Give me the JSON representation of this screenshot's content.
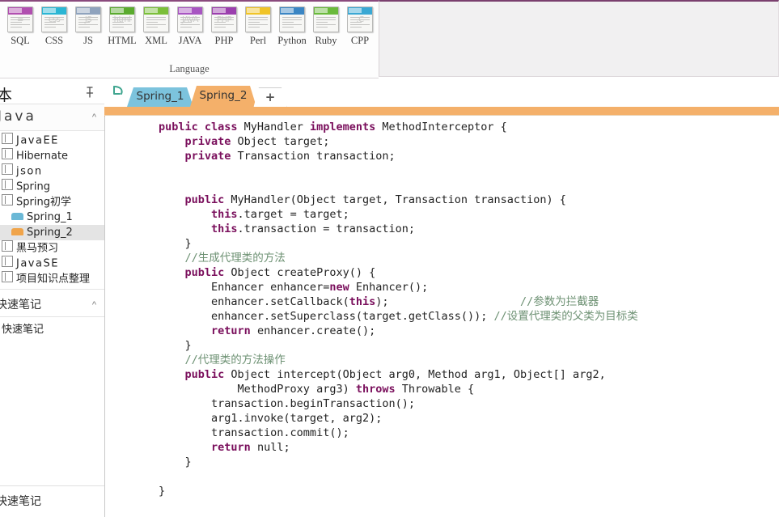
{
  "ribbon": {
    "group_title": "Language",
    "languages": [
      {
        "label": "SQL",
        "icon": "sql-file-icon",
        "color": "#b14fb0",
        "glyph": "≡"
      },
      {
        "label": "CSS",
        "icon": "css-file-icon",
        "color": "#2bb6d4",
        "glyph": "css"
      },
      {
        "label": "JS",
        "icon": "js-file-icon",
        "color": "#8fa3bd",
        "glyph": "JS"
      },
      {
        "label": "HTML",
        "icon": "html-file-icon",
        "color": "#5aab2e",
        "glyph": "html"
      },
      {
        "label": "XML",
        "icon": "xml-file-icon",
        "color": "#7bbf3a",
        "glyph": ""
      },
      {
        "label": "JAVA",
        "icon": "java-file-icon",
        "color": "#a855c2",
        "glyph": "JAVA"
      },
      {
        "label": "PHP",
        "icon": "php-file-icon",
        "color": "#9b3fae",
        "glyph": "PHP"
      },
      {
        "label": "Perl",
        "icon": "perl-file-icon",
        "color": "#f0c428",
        "glyph": ""
      },
      {
        "label": "Python",
        "icon": "python-file-icon",
        "color": "#3b86c4",
        "glyph": ""
      },
      {
        "label": "Ruby",
        "icon": "ruby-file-icon",
        "color": "#6aba3c",
        "glyph": ""
      },
      {
        "label": "CPP",
        "icon": "cpp-file-icon",
        "color": "#3aa8d4",
        "glyph": ".C"
      }
    ]
  },
  "sidebar": {
    "top_title": "本",
    "pin_icon": "pin-icon",
    "section_header": {
      "label": "Java",
      "chevron": "chevron-up-icon"
    },
    "items": [
      {
        "label": "JavaEE",
        "icon": "notebook-icon",
        "indent": false,
        "selected": false,
        "spaced": true
      },
      {
        "label": "Hibernate",
        "icon": "notebook-icon",
        "indent": false,
        "selected": false,
        "spaced": false
      },
      {
        "label": "json",
        "icon": "notebook-icon",
        "indent": false,
        "selected": false,
        "spaced": true
      },
      {
        "label": "Spring",
        "icon": "notebook-icon",
        "indent": false,
        "selected": false,
        "spaced": false
      },
      {
        "label": "Spring初学",
        "icon": "notebook-icon",
        "indent": false,
        "selected": false,
        "spaced": false
      },
      {
        "label": "Spring_1",
        "icon": "section-tab-icon",
        "indent": true,
        "selected": false,
        "color": "#6bb8d6",
        "spaced": false
      },
      {
        "label": "Spring_2",
        "icon": "section-tab-icon",
        "indent": true,
        "selected": true,
        "color": "#f0a44a",
        "spaced": false
      },
      {
        "label": "黑马预习",
        "icon": "notebook-icon",
        "indent": false,
        "selected": false,
        "spaced": false
      },
      {
        "label": "JavaSE",
        "icon": "notebook-icon",
        "indent": false,
        "selected": false,
        "spaced": true
      },
      {
        "label": "项目知识点整理",
        "icon": "notebook-icon",
        "indent": false,
        "selected": false,
        "spaced": false
      }
    ],
    "quick_notes_section": {
      "label": "快速笔记",
      "chevron": "chevron-up-icon"
    },
    "quick_notes_item": {
      "label": "快速笔记"
    },
    "footer_item": {
      "label": "快速笔记"
    }
  },
  "tabstrip": {
    "undo_icon": "undo-arrow-icon",
    "tabs": [
      {
        "label": "Spring_1",
        "color": "#7cc3dd",
        "active": false
      },
      {
        "label": "Spring_2",
        "color": "#f4b06a",
        "active": true
      }
    ],
    "add_tab": {
      "label": "+",
      "icon": "plus-icon"
    },
    "active_color": "#f4b06a",
    "underline_color": "#f0a970"
  },
  "code": {
    "lines": [
      [
        {
          "t": "kw",
          "s": "public class "
        },
        {
          "t": "pl",
          "s": "MyHandler "
        },
        {
          "t": "kw",
          "s": "implements "
        },
        {
          "t": "pl",
          "s": "MethodInterceptor {"
        }
      ],
      [
        {
          "t": "pl",
          "s": "    "
        },
        {
          "t": "kw",
          "s": "private "
        },
        {
          "t": "pl",
          "s": "Object target;"
        }
      ],
      [
        {
          "t": "pl",
          "s": "    "
        },
        {
          "t": "kw",
          "s": "private "
        },
        {
          "t": "pl",
          "s": "Transaction transaction;"
        }
      ],
      [
        {
          "t": "pl",
          "s": ""
        }
      ],
      [
        {
          "t": "pl",
          "s": ""
        }
      ],
      [
        {
          "t": "pl",
          "s": "    "
        },
        {
          "t": "kw",
          "s": "public "
        },
        {
          "t": "pl",
          "s": "MyHandler(Object target, Transaction transaction) {"
        }
      ],
      [
        {
          "t": "pl",
          "s": "        "
        },
        {
          "t": "kw",
          "s": "this"
        },
        {
          "t": "pl",
          "s": ".target = target;"
        }
      ],
      [
        {
          "t": "pl",
          "s": "        "
        },
        {
          "t": "kw",
          "s": "this"
        },
        {
          "t": "pl",
          "s": ".transaction = transaction;"
        }
      ],
      [
        {
          "t": "pl",
          "s": "    }"
        }
      ],
      [
        {
          "t": "pl",
          "s": "    "
        },
        {
          "t": "cm",
          "s": "//生成代理类的方法"
        }
      ],
      [
        {
          "t": "pl",
          "s": "    "
        },
        {
          "t": "kw",
          "s": "public "
        },
        {
          "t": "pl",
          "s": "Object createProxy() {"
        }
      ],
      [
        {
          "t": "pl",
          "s": "        Enhancer enhancer="
        },
        {
          "t": "kw",
          "s": "new "
        },
        {
          "t": "pl",
          "s": "Enhancer();"
        }
      ],
      [
        {
          "t": "pl",
          "s": "        enhancer.setCallback("
        },
        {
          "t": "kw",
          "s": "this"
        },
        {
          "t": "pl",
          "s": ");                    "
        },
        {
          "t": "cm",
          "s": "//参数为拦截器"
        }
      ],
      [
        {
          "t": "pl",
          "s": "        enhancer.setSuperclass(target.getClass()); "
        },
        {
          "t": "cm",
          "s": "//设置代理类的父类为目标类"
        }
      ],
      [
        {
          "t": "pl",
          "s": "        "
        },
        {
          "t": "kw",
          "s": "return "
        },
        {
          "t": "pl",
          "s": "enhancer.create();"
        }
      ],
      [
        {
          "t": "pl",
          "s": "    }"
        }
      ],
      [
        {
          "t": "pl",
          "s": "    "
        },
        {
          "t": "cm",
          "s": "//代理类的方法操作"
        }
      ],
      [
        {
          "t": "pl",
          "s": "    "
        },
        {
          "t": "kw",
          "s": "public "
        },
        {
          "t": "pl",
          "s": "Object intercept(Object arg0, Method arg1, Object[] arg2,"
        }
      ],
      [
        {
          "t": "pl",
          "s": "            MethodProxy arg3) "
        },
        {
          "t": "kw",
          "s": "throws "
        },
        {
          "t": "pl",
          "s": "Throwable {"
        }
      ],
      [
        {
          "t": "pl",
          "s": "        transaction.beginTransaction();"
        }
      ],
      [
        {
          "t": "pl",
          "s": "        arg1.invoke(target, arg2);"
        }
      ],
      [
        {
          "t": "pl",
          "s": "        transaction.commit();"
        }
      ],
      [
        {
          "t": "pl",
          "s": "        "
        },
        {
          "t": "kw",
          "s": "return "
        },
        {
          "t": "pl",
          "s": "null;"
        }
      ],
      [
        {
          "t": "pl",
          "s": "    }"
        }
      ],
      [
        {
          "t": "pl",
          "s": ""
        }
      ],
      [
        {
          "t": "pl",
          "s": "}"
        }
      ]
    ]
  }
}
